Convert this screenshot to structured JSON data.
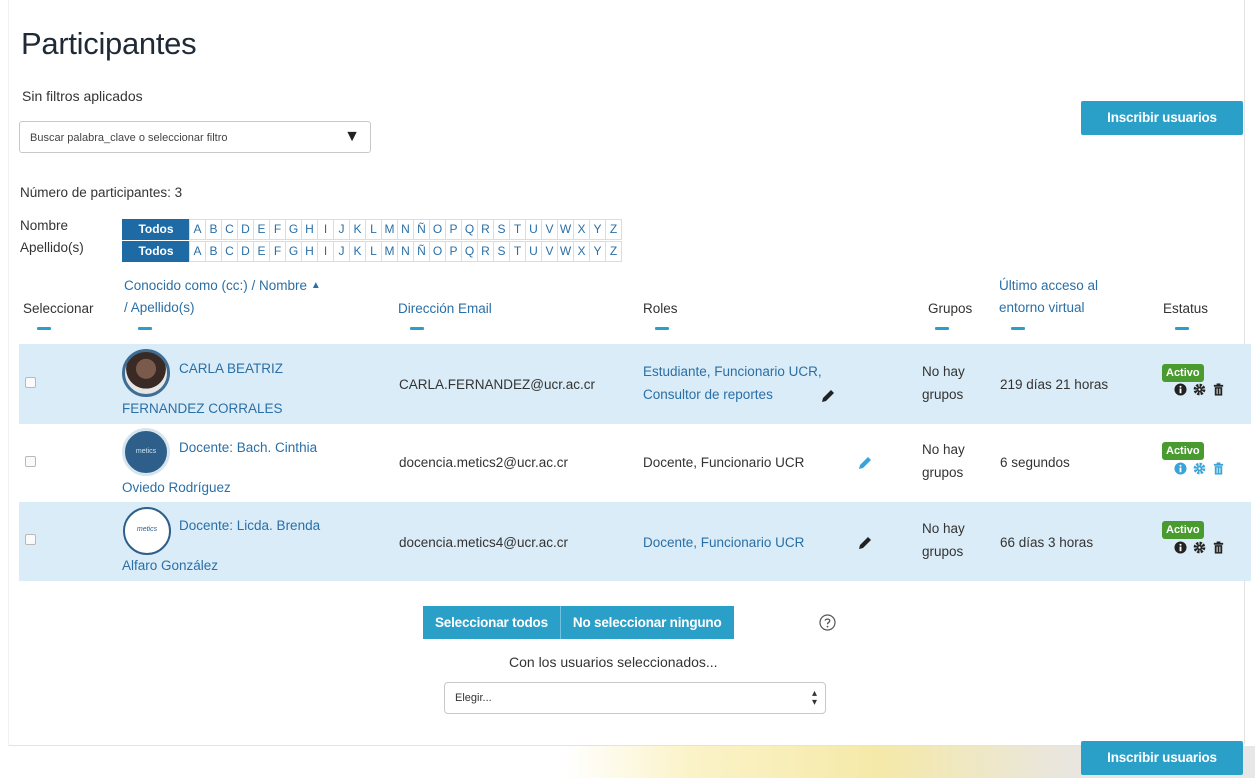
{
  "title": "Participantes",
  "filters": {
    "status_text": "Sin filtros aplicados",
    "select_placeholder": "Buscar palabra_clave o seleccionar filtro"
  },
  "enrol_button": "Inscribir usuarios",
  "participant_count": "Número de participantes: 3",
  "initials_bar": {
    "first_name_label": "Nombre",
    "last_name_label": "Apellido(s)",
    "all_label": "Todos",
    "letters": [
      "A",
      "B",
      "C",
      "D",
      "E",
      "F",
      "G",
      "H",
      "I",
      "J",
      "K",
      "L",
      "M",
      "N",
      "Ñ",
      "O",
      "P",
      "Q",
      "R",
      "S",
      "T",
      "U",
      "V",
      "W",
      "X",
      "Y",
      "Z"
    ]
  },
  "table": {
    "headers": {
      "select": "Seleccionar",
      "name_line1": "Conocido como (cc:) / Nombre",
      "name_line2": "/ Apellido(s)",
      "email": "Dirección Email",
      "roles": "Roles",
      "groups": "Grupos",
      "last_access_line1": "Último acceso al",
      "last_access_line2": "entorno virtual",
      "status": "Estatus"
    },
    "rows": [
      {
        "name_line1": "CARLA BEATRIZ",
        "name_line2": "FERNANDEZ CORRALES",
        "email": "CARLA.FERNANDEZ@ucr.ac.cr",
        "roles_line1": "Estudiante, Funcionario UCR,",
        "roles_line2": "Consultor de reportes",
        "groups_line1": "No hay",
        "groups_line2": "grupos",
        "last_access": "219 días 21 horas",
        "status": "Activo"
      },
      {
        "avatar_text": "metics",
        "name_line1": "Docente: Bach. Cinthia",
        "name_line2": "Oviedo Rodríguez",
        "email": "docencia.metics2@ucr.ac.cr",
        "roles_line1": "Docente, Funcionario UCR",
        "groups_line1": "No hay",
        "groups_line2": "grupos",
        "last_access": "6 segundos",
        "status": "Activo"
      },
      {
        "avatar_text": "metics",
        "name_line1": "Docente: Licda. Brenda",
        "name_line2": "Alfaro González",
        "email": "docencia.metics4@ucr.ac.cr",
        "roles_line1": "Docente, Funcionario UCR",
        "groups_line1": "No hay",
        "groups_line2": "grupos",
        "last_access": "66 días 3 horas",
        "status": "Activo"
      }
    ]
  },
  "bulk": {
    "select_all": "Seleccionar todos",
    "select_none": "No seleccionar ninguno",
    "with_selected": "Con los usuarios seleccionados...",
    "choose": "Elegir..."
  },
  "colors": {
    "accent": "#2aa0c9",
    "link": "#2b6fa6",
    "row_highlight": "#d9ecf7",
    "active_badge": "#4a9b2f"
  }
}
